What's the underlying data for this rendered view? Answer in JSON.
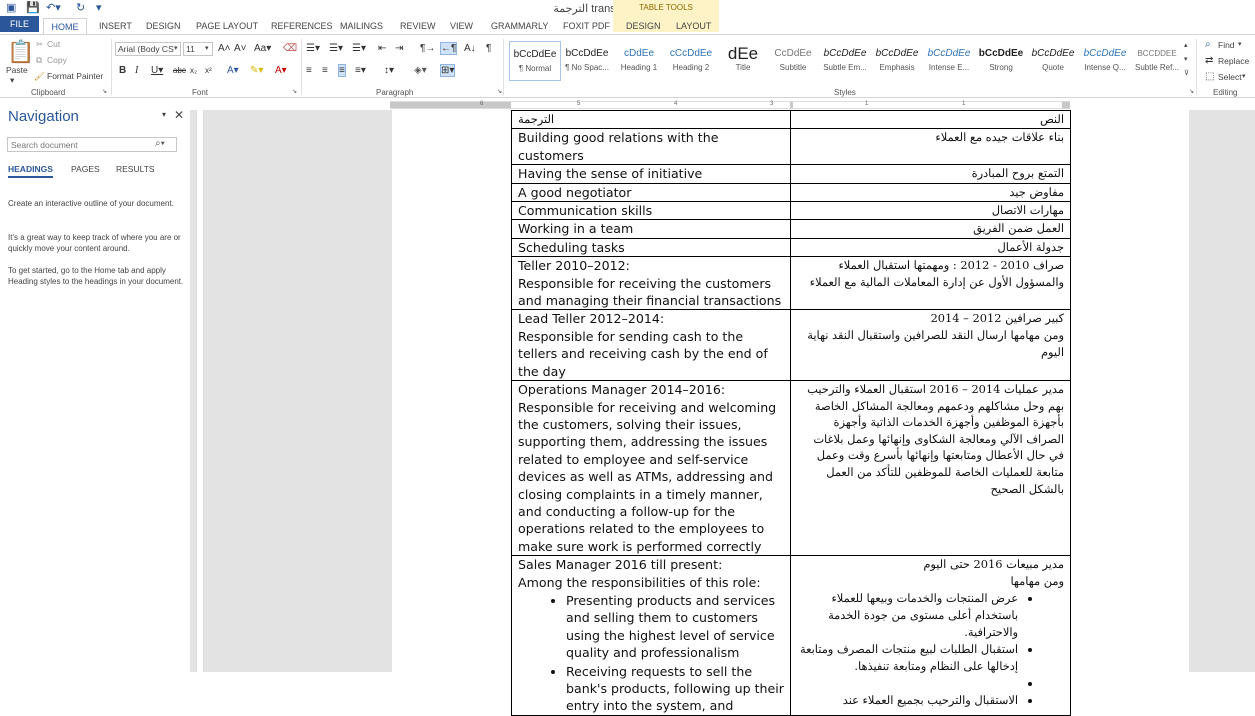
{
  "window": {
    "title": "الترجمة translated.docx - Word",
    "table_tools_label": "TABLE TOOLS"
  },
  "tabs": [
    "FILE",
    "HOME",
    "INSERT",
    "DESIGN",
    "PAGE LAYOUT",
    "REFERENCES",
    "MAILINGS",
    "REVIEW",
    "VIEW",
    "GRAMMARLY",
    "FOXIT PDF",
    "DESIGN",
    "LAYOUT"
  ],
  "ribbon": {
    "clipboard": {
      "paste": "Paste",
      "cut": "Cut",
      "copy": "Copy",
      "format_painter": "Format Painter",
      "label": "Clipboard"
    },
    "font": {
      "name": "Arial (Body CS",
      "size": "11",
      "label": "Font"
    },
    "paragraph": {
      "label": "Paragraph"
    },
    "styles": {
      "label": "Styles",
      "items": [
        {
          "preview": "bCcDdEe",
          "name": "¶ Normal"
        },
        {
          "preview": "bCcDdEe",
          "name": "¶ No Spac..."
        },
        {
          "preview": "cDdEe",
          "name": "Heading 1"
        },
        {
          "preview": "cCcDdEe",
          "name": "Heading 2"
        },
        {
          "preview": "dEe",
          "name": "Title"
        },
        {
          "preview": "CcDdEe",
          "name": "Subtitle"
        },
        {
          "preview": "bCcDdEe",
          "name": "Subtle Em..."
        },
        {
          "preview": "bCcDdEe",
          "name": "Emphasis"
        },
        {
          "preview": "bCcDdEe",
          "name": "Intense E..."
        },
        {
          "preview": "bCcDdEe",
          "name": "Strong"
        },
        {
          "preview": "bCcDdEe",
          "name": "Quote"
        },
        {
          "preview": "bCcDdEe",
          "name": "Intense Q..."
        },
        {
          "preview": "BCCDDEE",
          "name": "Subtle Ref..."
        }
      ]
    },
    "editing": {
      "find": "Find",
      "replace": "Replace",
      "select": "Select",
      "label": "Editing"
    }
  },
  "ruler": {
    "numbers": [
      "6",
      "5",
      "4",
      "3",
      "2",
      "1",
      "1",
      "2",
      "3",
      "1"
    ]
  },
  "navigation": {
    "title": "Navigation",
    "search_placeholder": "Search document",
    "tabs": [
      "HEADINGS",
      "PAGES",
      "RESULTS"
    ],
    "p1": "Create an interactive outline of your document.",
    "p2": "It's a great way to keep track of where you are or quickly move your content around.",
    "p3": "To get started, go to the Home tab and apply Heading styles to the headings in your document."
  },
  "table": {
    "rows": [
      {
        "en": [
          "الترجمة"
        ],
        "ar": [
          "النص"
        ]
      },
      {
        "en": [
          "Building good relations with the customers"
        ],
        "ar": [
          "بناء علاقات جيده مع العملاء"
        ]
      },
      {
        "en": [
          "Having the sense of initiative"
        ],
        "ar": [
          "التمتع بروح المبادرة"
        ]
      },
      {
        "en": [
          "A good negotiator"
        ],
        "ar": [
          "مفاوض جيد"
        ]
      },
      {
        "en": [
          "Communication skills"
        ],
        "ar": [
          "مهارات الاتصال"
        ]
      },
      {
        "en": [
          "Working in a team"
        ],
        "ar": [
          "العمل ضمن الفريق"
        ]
      },
      {
        "en": [
          "Scheduling tasks"
        ],
        "ar": [
          "جدولة الأعمال"
        ]
      },
      {
        "en": [
          "Teller 2010–2012:",
          "Responsible for receiving the customers and managing their financial transactions"
        ],
        "ar": [
          "صراف 2010 - 2012 : ومهمتها استقبال العملاء والمسؤول الأول عن إدارة المعاملات المالية مع العملاء"
        ]
      },
      {
        "en": [
          "Lead Teller 2012–2014:",
          "Responsible for sending cash to the tellers and receiving cash by the end of the day"
        ],
        "ar": [
          "كبير صرافين 2012 – 2014",
          "ومن مهامها ارسال النقد للصرافين واستقبال النقد نهاية اليوم"
        ]
      },
      {
        "en": [
          "Operations Manager 2014–2016:",
          "Responsible for receiving and welcoming the customers, solving their issues, supporting them, addressing the issues related to employee and self-service devices as well as ATMs, addressing and closing complaints in a timely manner, and conducting a follow-up for the operations related to the employees to make sure work is performed correctly"
        ],
        "ar": [
          "مدير عمليات 2014 – 2016 استقبال العملاء والترحيب بهم وحل مشاكلهم ودعمهم ومعالجة المشاكل الخاصة بأجهزة الموظفين وأجهزة الخدمات الذاتية وأجهزة الصراف الآلي ومعالجة الشكاوى وإنهائها وعمل بلاغات في حال الأعطال ومتابعتها وإنهائها بأسرع وقت وعمل متابعة للعمليات الخاصة للموظفين للتأكد من العمل بالشكل الصحيح"
        ]
      },
      {
        "en": [
          "Sales Manager 2016 till present:",
          "Among the responsibilities of this role:"
        ],
        "en_bullets": [
          "Presenting products and services and selling them to customers using the highest level of service quality and professionalism",
          "Receiving requests to sell the bank's products, following up their entry into the system, and"
        ],
        "ar": [
          "مدير مبيعات 2016 حتى اليوم",
          "ومن مهامها"
        ],
        "ar_bullets": [
          "عرض المنتجات والخدمات وبيعها للعملاء باستخدام أعلى مستوى من جودة الخدمة والاحترافية.",
          "استقبال الطلبات لبيع منتجات المصرف ومتابعة إدخالها على النظام ومتابعة تنفيذها.",
          "",
          "الاستقبال والترحيب بجميع العملاء عند"
        ]
      }
    ]
  }
}
